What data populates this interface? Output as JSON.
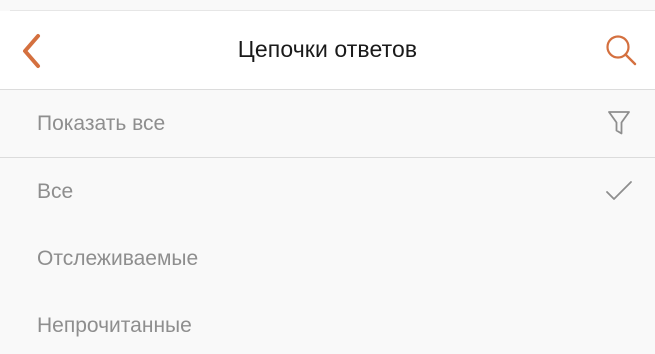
{
  "colors": {
    "accent": "#d4703f",
    "muted_text": "#8e8e8e",
    "title_text": "#1a1a1a",
    "divider": "#dcdcdc",
    "background": "#f9f9f9",
    "navbar_background": "#ffffff"
  },
  "navbar": {
    "title": "Цепочки ответов",
    "back_icon": "chevron-left-icon",
    "search_icon": "search-icon"
  },
  "filter": {
    "label": "Показать все",
    "icon": "filter-icon"
  },
  "options": [
    {
      "label": "Все",
      "selected": true
    },
    {
      "label": "Отслеживаемые",
      "selected": false
    },
    {
      "label": "Непрочитанные",
      "selected": false
    }
  ]
}
